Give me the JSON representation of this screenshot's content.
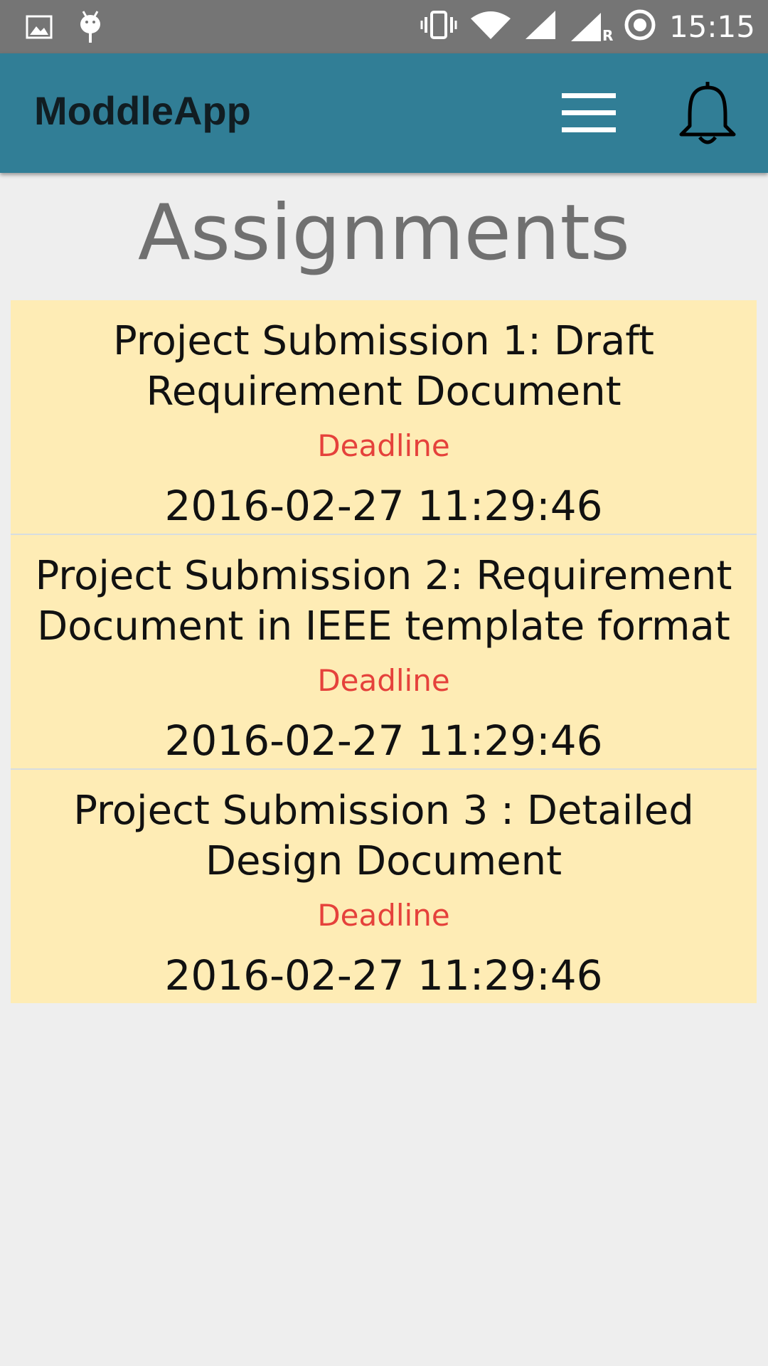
{
  "status_bar": {
    "time": "15:15",
    "left_icons": [
      "image-icon",
      "android-debug-icon"
    ],
    "right_icons": [
      "vibrate-icon",
      "wifi-icon",
      "signal-icon",
      "roaming-signal-icon",
      "sync-icon"
    ],
    "roaming_label": "R"
  },
  "app_bar": {
    "title": "ModdleApp",
    "background": "#317e96",
    "menu_icon": "hamburger-menu-icon",
    "notification_icon": "bell-icon"
  },
  "page": {
    "heading": "Assignments"
  },
  "assignments": [
    {
      "title": "Project Submission 1: Draft Requirement Document",
      "deadline_label": "Deadline",
      "deadline": "2016-02-27 11:29:46"
    },
    {
      "title": "Project Submission 2: Requirement Document in IEEE template format",
      "deadline_label": "Deadline",
      "deadline": "2016-02-27 11:29:46"
    },
    {
      "title": "Project Submission 3 : Detailed Design Document",
      "deadline_label": "Deadline",
      "deadline": "2016-02-27 11:29:46"
    }
  ],
  "colors": {
    "card_background": "#feecb5",
    "deadline_label": "#e5413b",
    "heading": "#707070",
    "status_bar": "#757575"
  }
}
